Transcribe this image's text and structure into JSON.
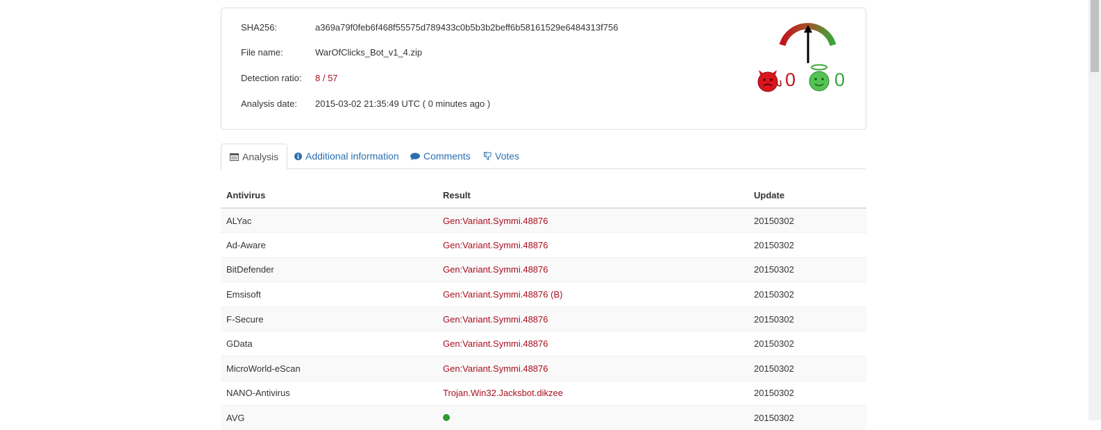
{
  "summary": {
    "sha256_label": "SHA256:",
    "sha256_value": "a369a79f0feb6f468f55575d789433c0b5b3b2beff6b58161529e6484313f756",
    "filename_label": "File name:",
    "filename_value": "WarOfClicks_Bot_v1_4.zip",
    "ratio_label": "Detection ratio:",
    "ratio_value": "8 / 57",
    "date_label": "Analysis date:",
    "date_value": "2015-03-02 21:35:49 UTC ( 0 minutes ago )"
  },
  "votes": {
    "malicious_count": "0",
    "harmless_count": "0",
    "colors": {
      "malicious": "#c0141e",
      "harmless": "#3aa53a"
    }
  },
  "tabs": [
    {
      "label": "Analysis",
      "icon": "table-icon",
      "active": true
    },
    {
      "label": "Additional information",
      "icon": "info-icon",
      "active": false
    },
    {
      "label": "Comments",
      "icon": "comment-icon",
      "active": false
    },
    {
      "label": "Votes",
      "icon": "thumbs-down-icon",
      "active": false
    }
  ],
  "table": {
    "headers": [
      "Antivirus",
      "Result",
      "Update"
    ],
    "rows": [
      {
        "antivirus": "ALYac",
        "result": "Gen:Variant.Symmi.48876",
        "update": "20150302"
      },
      {
        "antivirus": "Ad-Aware",
        "result": "Gen:Variant.Symmi.48876",
        "update": "20150302"
      },
      {
        "antivirus": "BitDefender",
        "result": "Gen:Variant.Symmi.48876",
        "update": "20150302"
      },
      {
        "antivirus": "Emsisoft",
        "result": "Gen:Variant.Symmi.48876 (B)",
        "update": "20150302"
      },
      {
        "antivirus": "F-Secure",
        "result": "Gen:Variant.Symmi.48876",
        "update": "20150302"
      },
      {
        "antivirus": "GData",
        "result": "Gen:Variant.Symmi.48876",
        "update": "20150302"
      },
      {
        "antivirus": "MicroWorld-eScan",
        "result": "Gen:Variant.Symmi.48876",
        "update": "20150302"
      },
      {
        "antivirus": "NANO-Antivirus",
        "result": "Trojan.Win32.Jacksbot.dikzee",
        "update": "20150302"
      },
      {
        "antivirus": "AVG",
        "result": "",
        "update": "20150302",
        "clean": true
      }
    ]
  }
}
